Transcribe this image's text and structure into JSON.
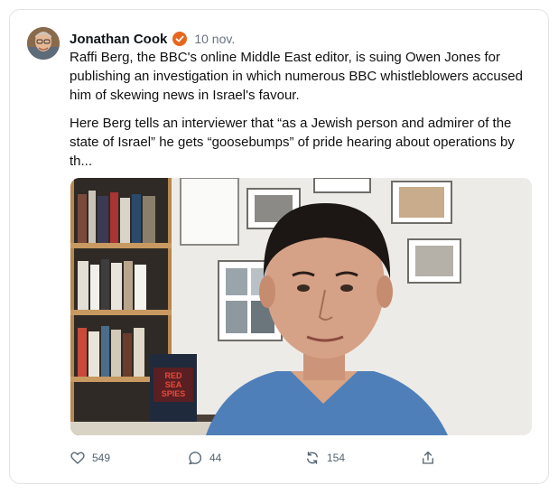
{
  "post": {
    "author_name": "Jonathan Cook",
    "date": "10 nov.",
    "paragraph_1": "Raffi Berg, the BBC's online Middle East editor, is suing Owen Jones for publishing an investigation in which numerous BBC whistleblowers accused him of skewing news in Israel's favour.",
    "paragraph_2": "Here Berg tells an interviewer that “as a Jewish person and admirer of the state of Israel” he gets “goosebumps” of pride hearing about operations by th...",
    "book_title_line1": "RED",
    "book_title_line2": "SEA",
    "book_title_line3": "SPIES"
  },
  "actions": {
    "likes": "549",
    "replies": "44",
    "reposts": "154"
  },
  "icons": {
    "verified": "verified-badge-icon",
    "like": "heart-icon",
    "reply": "speech-bubble-icon",
    "repost": "repost-icon",
    "share": "share-icon"
  },
  "colors": {
    "verified_badge": "#e8661e",
    "secondary_text": "#536471"
  }
}
